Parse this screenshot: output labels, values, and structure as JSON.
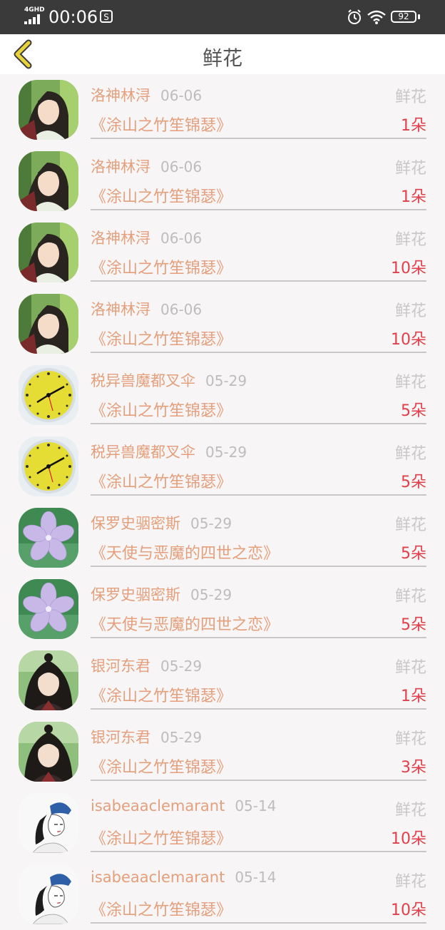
{
  "status_bar": {
    "network": "4GHD",
    "time": "00:06",
    "battery": "92"
  },
  "header": {
    "title": "鲜花"
  },
  "records": [
    {
      "name": "洛神林浔",
      "date": "06-06",
      "kind": "鲜花",
      "book": "《涂山之竹笙锦瑟》",
      "count": "1朵",
      "avatar": "boy-green-avatar"
    },
    {
      "name": "洛神林浔",
      "date": "06-06",
      "kind": "鲜花",
      "book": "《涂山之竹笙锦瑟》",
      "count": "1朵",
      "avatar": "boy-green-avatar"
    },
    {
      "name": "洛神林浔",
      "date": "06-06",
      "kind": "鲜花",
      "book": "《涂山之竹笙锦瑟》",
      "count": "10朵",
      "avatar": "boy-green-avatar"
    },
    {
      "name": "洛神林浔",
      "date": "06-06",
      "kind": "鲜花",
      "book": "《涂山之竹笙锦瑟》",
      "count": "10朵",
      "avatar": "boy-green-avatar"
    },
    {
      "name": "税异兽魔都叉伞",
      "date": "05-29",
      "kind": "鲜花",
      "book": "《涂山之竹笙锦瑟》",
      "count": "5朵",
      "avatar": "clock-avatar"
    },
    {
      "name": "税异兽魔都叉伞",
      "date": "05-29",
      "kind": "鲜花",
      "book": "《涂山之竹笙锦瑟》",
      "count": "5朵",
      "avatar": "clock-avatar"
    },
    {
      "name": "保罗史骃密斯",
      "date": "05-29",
      "kind": "鲜花",
      "book": "《天使与恶魔的四世之恋》",
      "count": "5朵",
      "avatar": "flower-avatar"
    },
    {
      "name": "保罗史骃密斯",
      "date": "05-29",
      "kind": "鲜花",
      "book": "《天使与恶魔的四世之恋》",
      "count": "5朵",
      "avatar": "flower-avatar"
    },
    {
      "name": "银河东君",
      "date": "05-29",
      "kind": "鲜花",
      "book": "《涂山之竹笙锦瑟》",
      "count": "1朵",
      "avatar": "boy-dark-avatar"
    },
    {
      "name": "银河东君",
      "date": "05-29",
      "kind": "鲜花",
      "book": "《涂山之竹笙锦瑟》",
      "count": "3朵",
      "avatar": "boy-dark-avatar"
    },
    {
      "name": "isabeaaclemarant",
      "date": "05-14",
      "kind": "鲜花",
      "book": "《涂山之竹笙锦瑟》",
      "count": "10朵",
      "avatar": "sketch-avatar"
    },
    {
      "name": "isabeaaclemarant",
      "date": "05-14",
      "kind": "鲜花",
      "book": "《涂山之竹笙锦瑟》",
      "count": "10朵",
      "avatar": "sketch-avatar"
    }
  ],
  "colors": {
    "name": "#e49f7c",
    "date": "#bdbdbd",
    "count": "#e0404a",
    "back": "#e8d33a"
  }
}
